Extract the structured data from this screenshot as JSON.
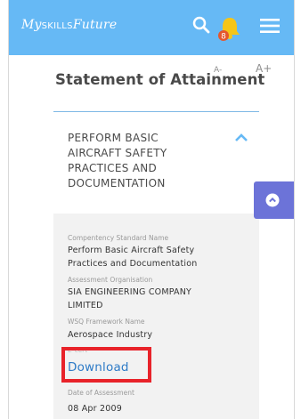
{
  "header": {
    "logo_prefix": "My",
    "logo_caps": "SKILLS",
    "logo_suffix": "Future",
    "bell_badge": "8"
  },
  "font_controls": {
    "decrease": "A-",
    "increase": "A+"
  },
  "page": {
    "title": "Statement of Attainment"
  },
  "section": {
    "title": "PERFORM BASIC AIRCRAFT SAFETY PRACTICES AND DOCUMENTATION"
  },
  "details": {
    "competency_label": "Compentency Standard Name",
    "competency_value": "Perform Basic Aircraft Safety Practices and Documentation",
    "organisation_label": "Assessment Organisation",
    "organisation_value": "SIA ENGINEERING COMPANY LIMITED",
    "framework_label": "WSQ Framework Name",
    "framework_value": "Aerospace Industry",
    "ecert_label": "E-cert",
    "download_label": "Download",
    "date_label": "Date of Assessment",
    "date_value": "08 Apr 2009"
  },
  "colors": {
    "header_bg": "#66b9f5",
    "accent_link": "#2e7bc7",
    "side_tab": "#6c73d8",
    "highlight": "#e8232a",
    "bell": "#f5c518",
    "badge": "#e4572e"
  },
  "icons": {
    "search": "search-icon",
    "bell": "bell-icon",
    "menu": "menu-icon",
    "collapse": "chevron-up-icon",
    "side_tab": "chevron-up-circle-icon"
  }
}
